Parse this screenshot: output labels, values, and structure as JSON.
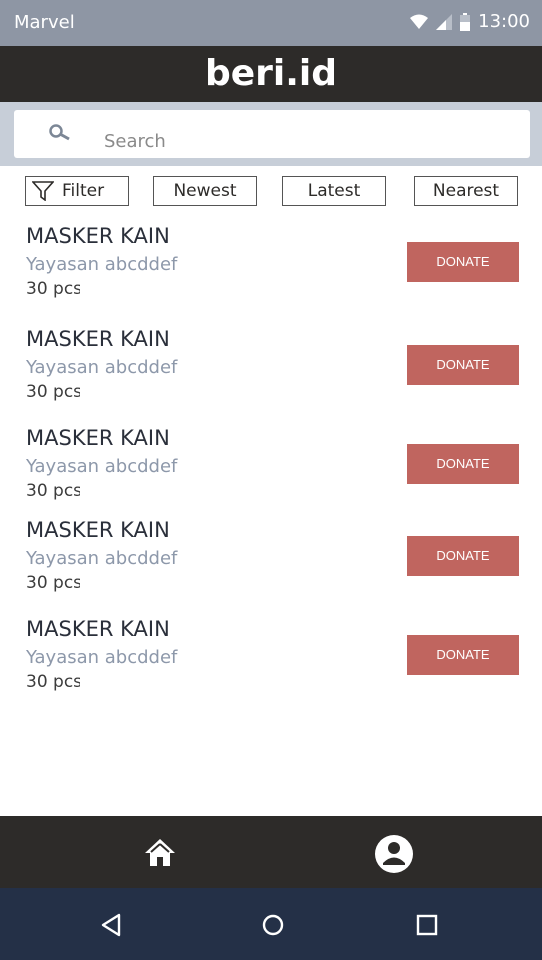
{
  "status_bar": {
    "carrier": "Marvel",
    "time": "13:00"
  },
  "header": {
    "title": "beri.id"
  },
  "search": {
    "placeholder": "Search"
  },
  "filters": {
    "filter_label": "Filter",
    "newest_label": "Newest",
    "latest_label": "Latest",
    "nearest_label": "Nearest"
  },
  "items": [
    {
      "name": "MASKER KAIN",
      "org": "Yayasan abcddef",
      "qty": "30 pcs",
      "button": "DONATE"
    },
    {
      "name": "MASKER KAIN",
      "org": "Yayasan abcddef",
      "qty": "30 pcs",
      "button": "DONATE"
    },
    {
      "name": "MASKER KAIN",
      "org": "Yayasan abcddef",
      "qty": "30 pcs",
      "button": "DONATE"
    },
    {
      "name": "MASKER KAIN",
      "org": "Yayasan abcddef",
      "qty": "30 pcs",
      "button": "DONATE"
    },
    {
      "name": "MASKER KAIN",
      "org": "Yayasan abcddef",
      "qty": "30 pcs",
      "button": "DONATE"
    }
  ],
  "bottom_nav": {
    "home_icon": "home-icon",
    "profile_icon": "profile-icon"
  },
  "colors": {
    "header": "#2d2b29",
    "status_bar": "#8e96a4",
    "donate_button": "#c0655f",
    "system_nav": "#243047"
  }
}
